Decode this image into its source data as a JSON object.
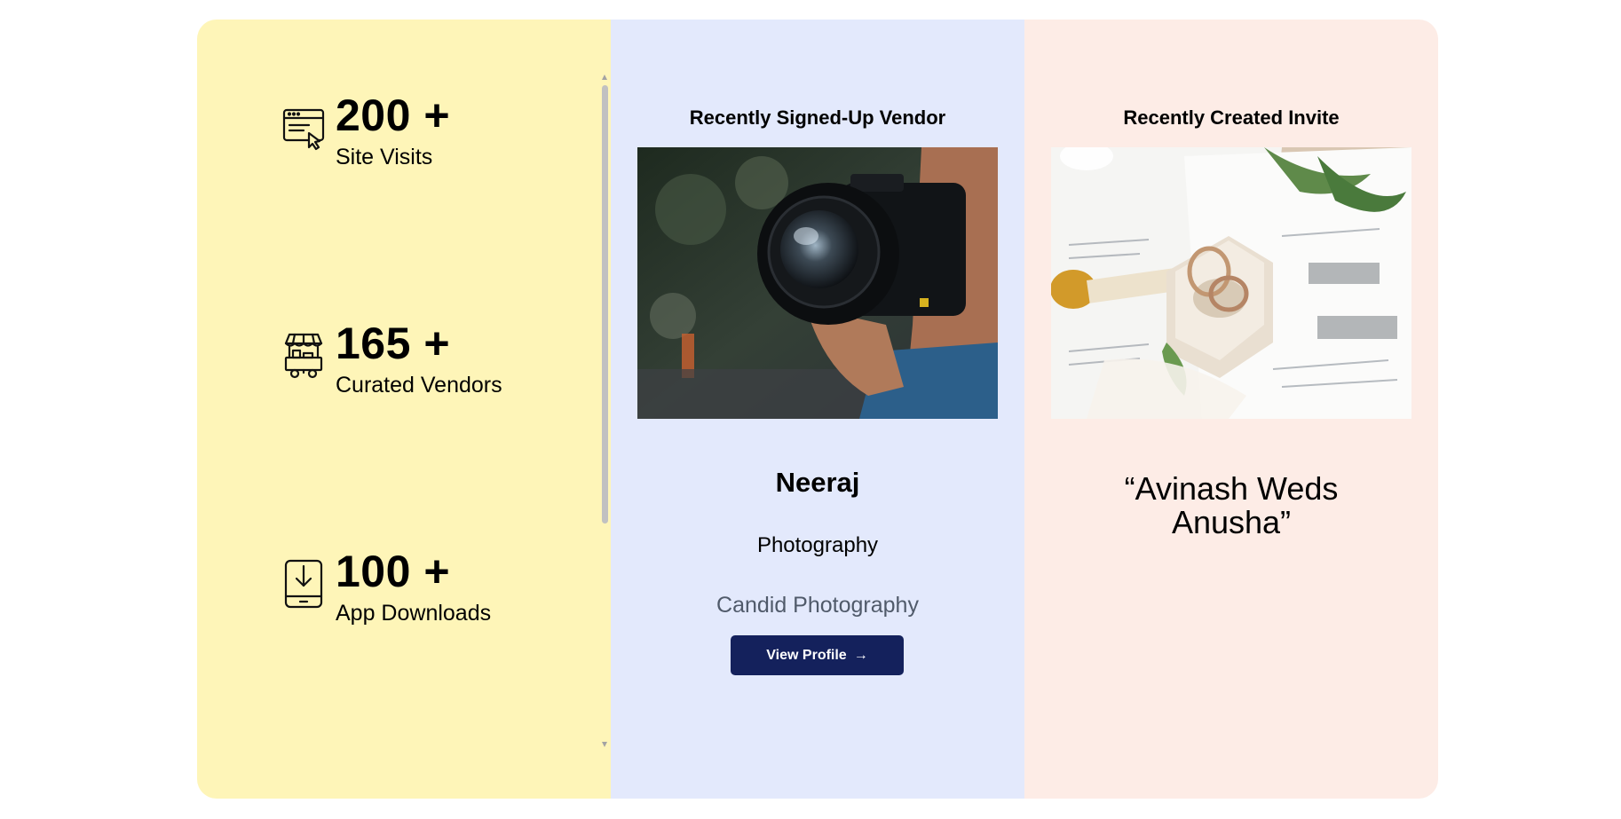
{
  "stats": [
    {
      "value": "200 +",
      "label": "Site Visits",
      "icon": "browser-cursor-icon"
    },
    {
      "value": "165 +",
      "label": "Curated Vendors",
      "icon": "vendor-cart-icon"
    },
    {
      "value": "100 +",
      "label": "App Downloads",
      "icon": "phone-download-icon"
    }
  ],
  "vendor": {
    "heading": "Recently Signed-Up Vendor",
    "name": "Neeraj",
    "category": "Photography",
    "subcategory": "Candid Photography",
    "button_label": "View Profile",
    "button_icon": "arrow-right-icon"
  },
  "invite": {
    "heading": "Recently Created Invite",
    "title": "“Avinash Weds Anusha”"
  },
  "colors": {
    "stats_bg": "#fef5b8",
    "vendor_bg": "#e3e9fc",
    "invite_bg": "#fdece6",
    "button_bg": "#14215c"
  }
}
